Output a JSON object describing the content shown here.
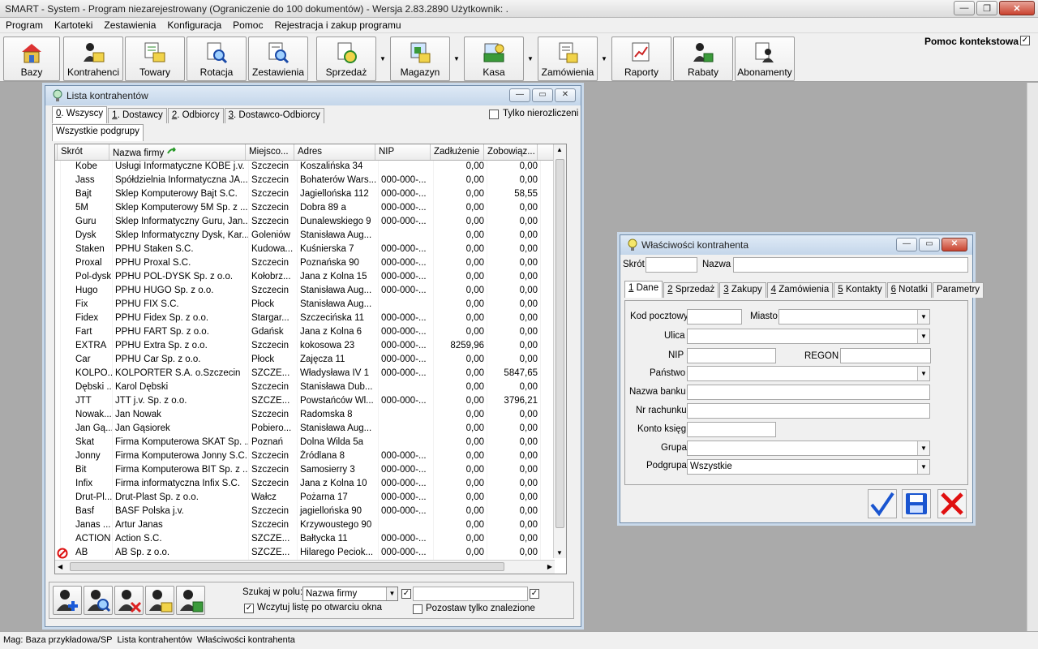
{
  "app": {
    "title": "SMART - System - Program niezarejestrowany (Ograniczenie do 100 dokumentów) - Wersja 2.83.2890     Użytkownik: ."
  },
  "menu": [
    "Program",
    "Kartoteki",
    "Zestawienia",
    "Konfiguracja",
    "Pomoc",
    "Rejestracja i zakup programu"
  ],
  "toolbar": {
    "buttons": [
      "Bazy",
      "Kontrahenci",
      "Towary",
      "Rotacja",
      "Zestawienia",
      "Sprzedaż",
      "Magazyn",
      "Kasa",
      "Zamówienia",
      "Raporty",
      "Rabaty",
      "Abonamenty"
    ],
    "help_label": "Pomoc kontekstowa",
    "help_checked": "✓"
  },
  "list_window": {
    "title": "Lista kontrahentów",
    "tabs": [
      {
        "key": "0",
        "label": ". Wszyscy"
      },
      {
        "key": "1",
        "label": ". Dostawcy"
      },
      {
        "key": "2",
        "label": ". Odbiorcy"
      },
      {
        "key": "3",
        "label": ". Dostawco-Odbiorcy"
      }
    ],
    "only_unsettled_label": "Tylko nierozliczeni",
    "subgroup_tab": "Wszystkie podgrupy",
    "columns": [
      "Skrót",
      "Nazwa firmy",
      "Miejsco...",
      "Adres",
      "NIP",
      "Zadłużenie",
      "Zobowiąz..."
    ],
    "rows": [
      [
        "Kobe",
        "Usługi Informatyczne KOBE j.v.",
        "Szczecin",
        "Koszalińska 34",
        "",
        "0,00",
        "0,00"
      ],
      [
        "Jass",
        "Spółdzielnia Informatyczna JA...",
        "Szczecin",
        "Bohaterów Wars...",
        "000-000-...",
        "0,00",
        "0,00"
      ],
      [
        "Bajt",
        "Sklep Komputerowy Bajt S.C.",
        "Szczecin",
        "Jagiellońska 112",
        "000-000-...",
        "0,00",
        "58,55"
      ],
      [
        "5M",
        "Sklep Komputerowy 5M Sp. z ...",
        "Szczecin",
        "Dobra 89 a",
        "000-000-...",
        "0,00",
        "0,00"
      ],
      [
        "Guru",
        "Sklep Informatyczny Guru, Jan...",
        "Szczecin",
        "Dunalewskiego 9",
        "000-000-...",
        "0,00",
        "0,00"
      ],
      [
        "Dysk",
        "Sklep Informatyczny Dysk, Kar...",
        "Goleniów",
        "Stanisława Aug...",
        "",
        "0,00",
        "0,00"
      ],
      [
        "Staken",
        "PPHU Staken S.C.",
        "Kudowa...",
        "Kuśnierska 7",
        "000-000-...",
        "0,00",
        "0,00"
      ],
      [
        "Proxal",
        "PPHU Proxal S.C.",
        "Szczecin",
        "Poznańska 90",
        "000-000-...",
        "0,00",
        "0,00"
      ],
      [
        "Pol-dysk",
        "PPHU POL-DYSK Sp. z o.o.",
        "Kołobrz...",
        "Jana z Kolna 15",
        "000-000-...",
        "0,00",
        "0,00"
      ],
      [
        "Hugo",
        "PPHU HUGO Sp. z o.o.",
        "Szczecin",
        "Stanisława Aug...",
        "000-000-...",
        "0,00",
        "0,00"
      ],
      [
        "Fix",
        "PPHU FIX S.C.",
        "Płock",
        "Stanisława Aug...",
        "",
        "0,00",
        "0,00"
      ],
      [
        "Fidex",
        "PPHU Fidex Sp. z o.o.",
        "Stargar...",
        "Szczecińska 11",
        "000-000-...",
        "0,00",
        "0,00"
      ],
      [
        "Fart",
        "PPHU FART Sp. z o.o.",
        "Gdańsk",
        "Jana z Kolna 6",
        "000-000-...",
        "0,00",
        "0,00"
      ],
      [
        "EXTRA",
        "PPHU Extra Sp. z o.o.",
        "Szczecin",
        "kokosowa 23",
        "000-000-...",
        "8259,96",
        "0,00"
      ],
      [
        "Car",
        "PPHU Car Sp. z o.o.",
        "Płock",
        "Zajęcza 11",
        "000-000-...",
        "0,00",
        "0,00"
      ],
      [
        "KOLPO...",
        "KOLPORTER S.A. o.Szczecin",
        "SZCZE...",
        "Władysława IV 1",
        "000-000-...",
        "0,00",
        "5847,65"
      ],
      [
        "Dębski ...",
        "Karol Dębski",
        "Szczecin",
        "Stanisława Dub...",
        "",
        "0,00",
        "0,00"
      ],
      [
        "JTT",
        "JTT j.v. Sp. z o.o.",
        "SZCZE...",
        "Powstańców Wl...",
        "000-000-...",
        "0,00",
        "3796,21"
      ],
      [
        "Nowak...",
        "Jan Nowak",
        "Szczecin",
        "Radomska 8",
        "",
        "0,00",
        "0,00"
      ],
      [
        "Jan Gą...",
        "Jan Gąsiorek",
        "Pobiero...",
        "Stanisława Aug...",
        "",
        "0,00",
        "0,00"
      ],
      [
        "Skat",
        "Firma Komputerowa SKAT Sp. ...",
        "Poznań",
        "Dolna Wilda 5a",
        "",
        "0,00",
        "0,00"
      ],
      [
        "Jonny",
        "Firma Komputerowa Jonny S.C.",
        "Szczecin",
        "Źródlana 8",
        "000-000-...",
        "0,00",
        "0,00"
      ],
      [
        "Bit",
        "Firma Komputerowa BIT Sp. z ...",
        "Szczecin",
        "Samosierry 3",
        "000-000-...",
        "0,00",
        "0,00"
      ],
      [
        "Infix",
        "Firma informatyczna Infix S.C.",
        "Szczecin",
        "Jana z Kolna 10",
        "000-000-...",
        "0,00",
        "0,00"
      ],
      [
        "Drut-Pl...",
        "Drut-Plast Sp. z o.o.",
        "Wałcz",
        "Pożarna 17",
        "000-000-...",
        "0,00",
        "0,00"
      ],
      [
        "Basf",
        "BASF Polska j.v.",
        "Szczecin",
        "jagiellońska 90",
        "000-000-...",
        "0,00",
        "0,00"
      ],
      [
        "Janas ...",
        "Artur Janas",
        "Szczecin",
        "Krzywoustego 90",
        "",
        "0,00",
        "0,00"
      ],
      [
        "ACTION",
        "Action S.C.",
        "SZCZE...",
        "Bałtycka 11",
        "000-000-...",
        "0,00",
        "0,00"
      ],
      [
        "AB",
        "AB Sp. z o.o.",
        "SZCZE...",
        "Hilarego Peciok...",
        "000-000-...",
        "0,00",
        "0,00"
      ]
    ],
    "search_label": "Szukaj w polu:",
    "search_field": "Nazwa firmy",
    "search_value": "",
    "load_on_open_label": "Wczytuj listę po otwarciu okna",
    "load_on_open_checked": "✓",
    "filter_checked": "✓",
    "search_checked": "✓",
    "leave_found_label": "Pozostaw tylko znalezione"
  },
  "props_window": {
    "title": "Właściwości kontrahenta",
    "skrot_label": "Skrót",
    "nazwa_label": "Nazwa",
    "tabs": [
      {
        "key": "1",
        "label": " Dane"
      },
      {
        "key": "2",
        "label": " Sprzedaż"
      },
      {
        "key": "3",
        "label": " Zakupy"
      },
      {
        "key": "4",
        "label": " Zamówienia"
      },
      {
        "key": "5",
        "label": " Kontakty"
      },
      {
        "key": "6",
        "label": " Notatki"
      },
      {
        "key": "",
        "label": "Parametry"
      }
    ],
    "fields": {
      "kod_pocztowy": "Kod pocztowy",
      "miasto": "Miasto",
      "ulica": "Ulica",
      "nip": "NIP",
      "regon": "REGON",
      "panstwo": "Państwo",
      "nazwa_banku": "Nazwa banku",
      "nr_rachunku": "Nr rachunku",
      "konto_ksieg": "Konto księg.",
      "grupa": "Grupa",
      "podgrupa": "Podgrupa",
      "podgrupa_value": "Wszystkie"
    }
  },
  "status": [
    "Mag: Baza przykładowa/SP",
    "Lista kontrahentów",
    "Właściwości kontrahenta"
  ]
}
